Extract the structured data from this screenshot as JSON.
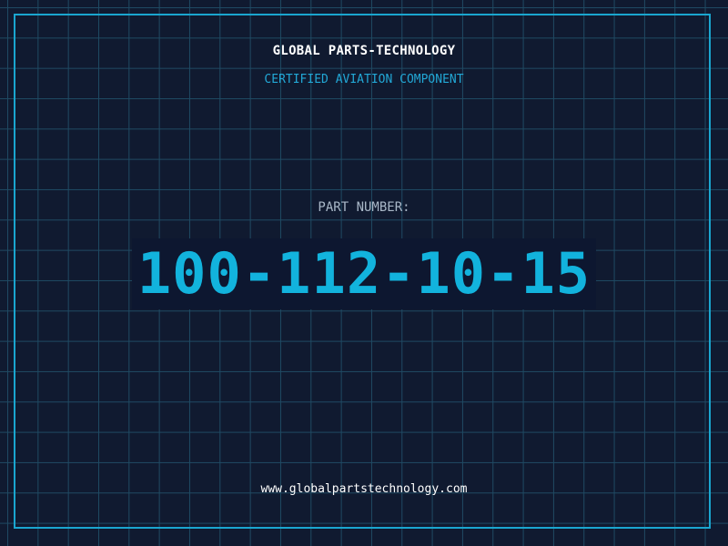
{
  "header": {
    "company": "GLOBAL PARTS-TECHNOLOGY",
    "certification": "CERTIFIED AVIATION COMPONENT"
  },
  "part": {
    "label": "PART NUMBER:",
    "number": "100-112-10-15"
  },
  "footer": {
    "url": "www.globalpartstechnology.com"
  },
  "colors": {
    "background": "#101a30",
    "grid": "#1f4a63",
    "accent": "#12b3dd",
    "frame": "#1aa6cf"
  }
}
